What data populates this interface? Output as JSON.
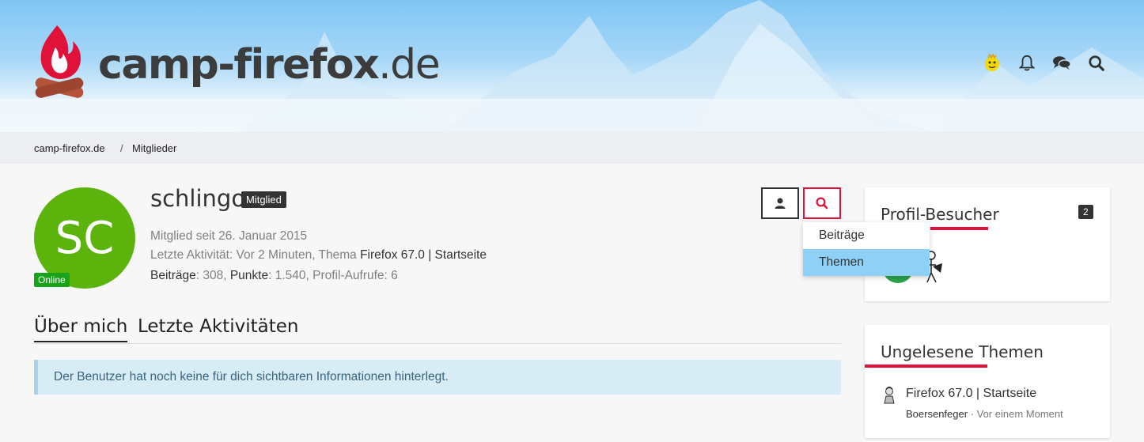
{
  "site": {
    "logo_main": "camp-firefox",
    "logo_tld": ".de"
  },
  "header_icons": [
    "user-avatar-icon",
    "bell-icon",
    "chat-icon",
    "search-icon"
  ],
  "breadcrumb": {
    "home": "camp-firefox.de",
    "separator": "/",
    "current": "Mitglieder"
  },
  "profile": {
    "initials": "SC",
    "online_label": "Online",
    "username": "schlingo",
    "rank": "Mitglied",
    "member_since": "Mitglied seit 26. Januar 2015",
    "last_activity_prefix": "Letzte Aktivität: Vor 2 Minuten, Thema ",
    "last_activity_topic": "Firefox 67.0 | Startseite",
    "stats": {
      "posts_label": "Beiträge",
      "posts_value": ": 308, ",
      "points_label": "Punkte",
      "points_value": ": 1.540, Profil-Aufrufe: 6"
    }
  },
  "dropdown": {
    "items": [
      "Beiträge",
      "Themen"
    ],
    "active": "Themen"
  },
  "tabs": [
    "Über mich",
    "Letzte Aktivitäten"
  ],
  "info_message": "Der Benutzer hat noch keine für dich sichtbaren Informationen hinterlegt.",
  "sidebar": {
    "visitors": {
      "title": "Profil-Besucher",
      "count": "2"
    },
    "unread": {
      "title": "Ungelesene Themen",
      "topic_title": "Firefox 67.0 | Startseite",
      "topic_author": "Boersenfeger",
      "topic_time": " · Vor einem Moment"
    }
  },
  "colors": {
    "accent": "#e0123a",
    "avatar": "#5cb30c",
    "online": "#19a31b",
    "dropdown_active": "#8fd0f7",
    "info_bg": "#d8ecf6"
  }
}
